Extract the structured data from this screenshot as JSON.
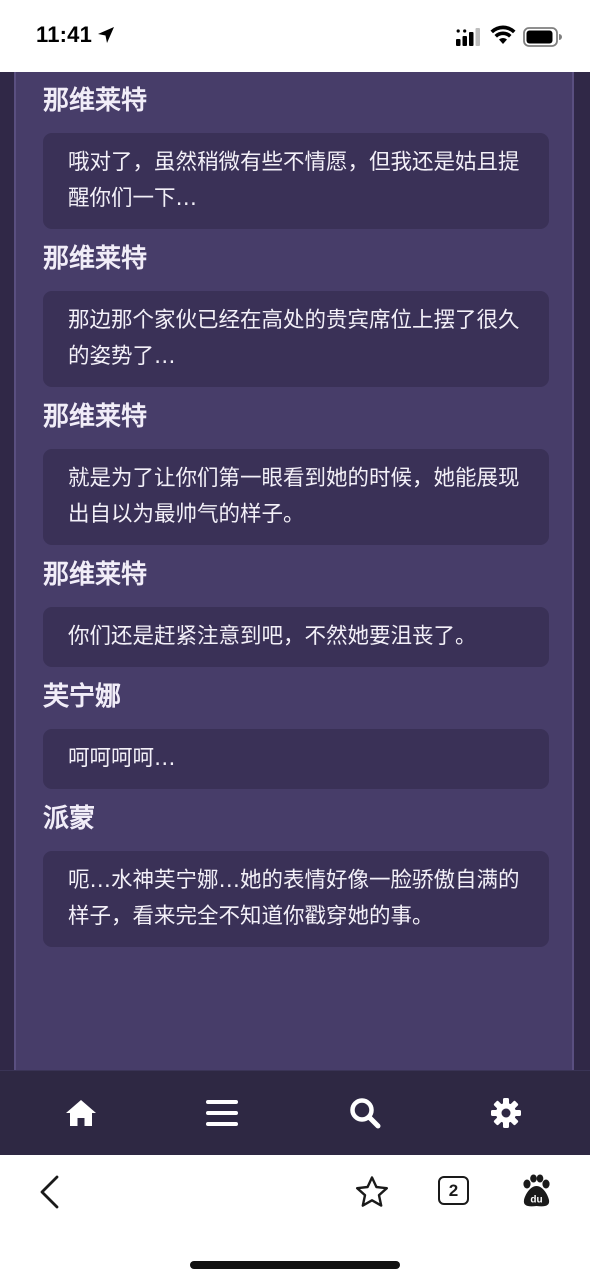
{
  "status_bar": {
    "time": "11:41",
    "icons": [
      "location-arrow-icon",
      "signal-icon",
      "wifi-icon",
      "battery-icon"
    ]
  },
  "dialogue": [
    {
      "speaker": "那维莱特",
      "text": "哦对了，虽然稍微有些不情愿，但我还是姑且提醒你们一下…"
    },
    {
      "speaker": "那维莱特",
      "text": "那边那个家伙已经在高处的贵宾席位上摆了很久的姿势了…"
    },
    {
      "speaker": "那维莱特",
      "text": "就是为了让你们第一眼看到她的时候，她能展现出自以为最帅气的样子。"
    },
    {
      "speaker": "那维莱特",
      "text": "你们还是赶紧注意到吧，不然她要沮丧了。"
    },
    {
      "speaker": "芙宁娜",
      "text": "呵呵呵呵…"
    },
    {
      "speaker": "派蒙",
      "text": "呃…水神芙宁娜…她的表情好像一脸骄傲自满的样子，看来完全不知道你戳穿她的事。"
    }
  ],
  "app_nav": {
    "items": [
      "home-icon",
      "menu-icon",
      "search-icon",
      "settings-icon"
    ]
  },
  "browser": {
    "tab_count": "2",
    "icons": [
      "back-icon",
      "star-icon",
      "tabs-icon",
      "baidu-paw-icon"
    ]
  },
  "colors": {
    "panel": "#473d69",
    "bubble": "#3a3157",
    "frame": "#302847",
    "nav": "#2e2843"
  }
}
